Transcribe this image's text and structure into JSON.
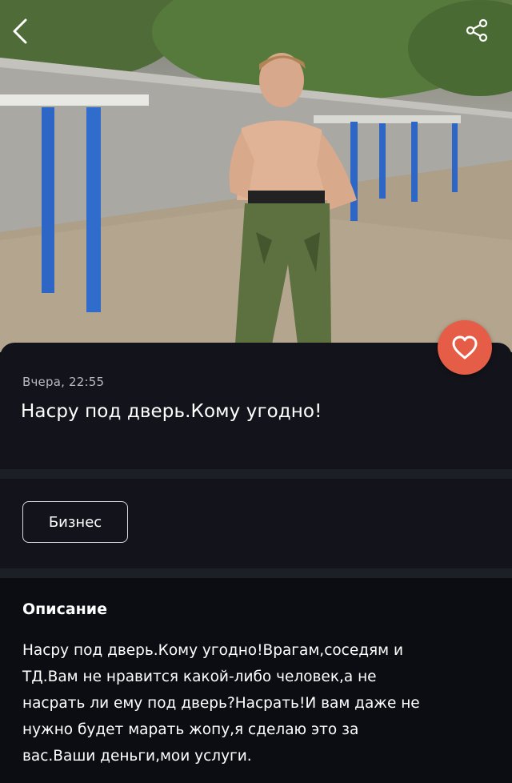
{
  "listing": {
    "date": "Вчера, 22:55",
    "title": "Насру под дверь.Кому угодно!",
    "category": "Бизнес",
    "description_heading": "Описание",
    "description_lines": [
      "Насру под дверь.Кому угодно!Врагам,соседям и",
      "ТД.Вам не нравится какой-либо человек,а не",
      "насрать ли ему под дверь?Насрать!И вам даже не",
      "нужно будет марать жопу,я сделаю это за",
      "вас.Ваши деньги,мои услуги."
    ]
  },
  "icons": {
    "back": "chevron-left-icon",
    "share": "share-icon",
    "favorite": "heart-icon"
  },
  "colors": {
    "background": "#0c0d12",
    "card": "#13141b",
    "separator": "#1d1f27",
    "favorite_button": "#e65d47",
    "secondary_text": "#b7b9c2"
  }
}
